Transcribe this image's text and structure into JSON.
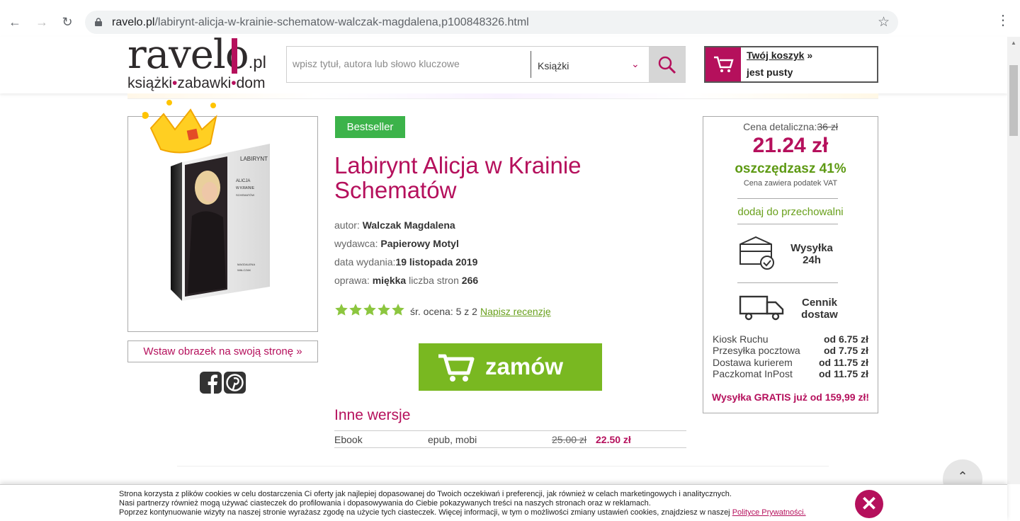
{
  "browser": {
    "url_host": "ravelo.pl",
    "url_path": "/labirynt-alicja-w-krainie-schematow-walczak-magdalena,p100848326.html",
    "back_icon": "arrow-left-icon",
    "forward_icon": "arrow-right-icon",
    "reload_icon": "reload-icon",
    "bookmark_icon": "star-icon",
    "menu_icon": "kebab-menu-icon"
  },
  "header": {
    "logo_main": "ravel",
    "logo_o": "o",
    "logo_pl": ".pl",
    "logo_sub1": "książki",
    "logo_sub2": "zabawki",
    "logo_sub3": "dom",
    "search_placeholder": "wpisz tytuł, autora lub słowo kluczowe",
    "search_category": "Książki",
    "cart_title": "Twój koszyk",
    "cart_arrow": " »",
    "cart_status": "jest pusty"
  },
  "product": {
    "badge": "Bestseller",
    "title": "Labirynt Alicja w Krainie Schematów",
    "author_label": "autor: ",
    "author": "Walczak Magdalena",
    "publisher_label": "wydawca: ",
    "publisher": "Papierowy Motyl",
    "date_label": "data wydania:",
    "date": "19 listopada 2019",
    "binding_label": "oprawa: ",
    "binding": "miękka",
    "pages_label": " liczba stron ",
    "pages": "266",
    "rating_stars": 5,
    "rating_text": "śr. ocena: 5 z 2",
    "review_link": "Napisz recenzję",
    "order_label": "zamów",
    "insert_image": "Wstaw obrazek na swoją stronę »",
    "cover_title": "LABIRYNT",
    "cover_sub": "ALICJA W KRAINIE SCHEMATÓW",
    "cover_author": "MAGDALENA WALCZAK"
  },
  "other_versions": {
    "title": "Inne wersje",
    "rows": [
      {
        "type": "Ebook",
        "formats": "epub, mobi",
        "old_price": "25.00 zł",
        "price": "22.50 zł"
      }
    ]
  },
  "price_box": {
    "retail_label": "Cena detaliczna:",
    "retail_price": "36 zł",
    "price": "21.24 zł",
    "savings": "oszczędzasz 41%",
    "vat_note": "Cena zawiera podatek VAT",
    "wishlist": "dodaj do przechowalni",
    "shipping_time_line1": "Wysyłka",
    "shipping_time_line2": "24h",
    "price_list_line1": "Cennik",
    "price_list_line2": "dostaw",
    "costs": [
      {
        "name": "Kiosk Ruchu",
        "price": "od 6.75 zł"
      },
      {
        "name": "Przesyłka pocztowa",
        "price": "od 7.75 zł"
      },
      {
        "name": "Dostawa kurierem",
        "price": "od 11.75 zł"
      },
      {
        "name": "Paczkomat InPost",
        "price": "od 11.75 zł"
      }
    ],
    "free_shipping": "Wysyłka GRATIS już od 159,99 zł!"
  },
  "cookie": {
    "line1": "Strona korzysta z plików cookies w celu dostarczenia Ci oferty jak najlepiej dopasowanej do Twoich oczekiwań i preferencji, jak również w celach marketingowych i analitycznych.",
    "line2": "Nasi partnerzy również mogą używać ciasteczek do profilowania i dopasowywania do Ciebie pokazywanych treści na naszych stronach oraz w reklamach.",
    "line3": "Poprzez kontynuowanie wizyty na naszej stronie wyrażasz zgodę na użycie tych ciasteczek. Więcej informacji, w tym o możliwości zmiany ustawień cookies, znajdziesz w naszej ",
    "policy_link": "Polityce Prywatności.",
    "close_icon": "close-icon"
  },
  "colors": {
    "brand": "#b5105c",
    "accent_green": "#79b821",
    "badge_green": "#3cb34a",
    "star_green": "#8cc63f"
  }
}
